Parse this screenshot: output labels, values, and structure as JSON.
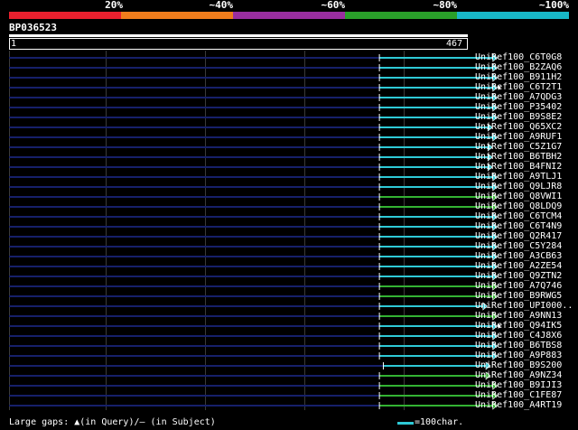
{
  "query": {
    "id": "BP036523",
    "start": "1",
    "end": "467",
    "length": 467
  },
  "identity_scale": {
    "labels": [
      "20%",
      "~40%",
      "~60%",
      "~80%",
      "~100%"
    ],
    "colors": [
      "#e8202e",
      "#f07d1c",
      "#9a2ea0",
      "#2aa02a",
      "#18b8c8"
    ]
  },
  "legend": {
    "gaps": "Large gaps: ▲(in Query)/— (in Subject)",
    "scale": "=100char."
  },
  "hits": [
    {
      "name": "UniRef100_C6T0G8",
      "start": 377,
      "end": 497,
      "color": "#2ec9d6",
      "flag": false
    },
    {
      "name": "UniRef100_B2ZAQ6",
      "start": 377,
      "end": 497,
      "color": "#2ec9d6",
      "flag": false
    },
    {
      "name": "UniRef100_B911H2",
      "start": 377,
      "end": 497,
      "color": "#2ec9d6",
      "flag": false
    },
    {
      "name": "UniRef100_C6T2T1",
      "start": 377,
      "end": 497,
      "color": "#2ec9d6",
      "flag": true
    },
    {
      "name": "UniRef100_A7QDG3",
      "start": 377,
      "end": 497,
      "color": "#2ec9d6",
      "flag": false
    },
    {
      "name": "UniRef100_P35402",
      "start": 377,
      "end": 497,
      "color": "#2ec9d6",
      "flag": false
    },
    {
      "name": "UniRef100_B9S8E2",
      "start": 377,
      "end": 497,
      "color": "#2ec9d6",
      "flag": false
    },
    {
      "name": "UniRef100_Q65XC2",
      "start": 377,
      "end": 492,
      "color": "#2ec9d6",
      "flag": false
    },
    {
      "name": "UniRef100_A9RUF1",
      "start": 377,
      "end": 497,
      "color": "#2ec9d6",
      "flag": false
    },
    {
      "name": "UniRef100_C5Z1G7",
      "start": 377,
      "end": 492,
      "color": "#2ec9d6",
      "flag": false
    },
    {
      "name": "UniRef100_B6TBH2",
      "start": 377,
      "end": 492,
      "color": "#2ec9d6",
      "flag": false
    },
    {
      "name": "UniRef100_B4FNI2",
      "start": 377,
      "end": 492,
      "color": "#2ec9d6",
      "flag": false
    },
    {
      "name": "UniRef100_A9TLJ1",
      "start": 377,
      "end": 497,
      "color": "#2ec9d6",
      "flag": false
    },
    {
      "name": "UniRef100_Q9LJR8",
      "start": 377,
      "end": 497,
      "color": "#2ec9d6",
      "flag": false
    },
    {
      "name": "UniRef100_Q8VWI1",
      "start": 377,
      "end": 497,
      "color": "#33b233",
      "flag": false
    },
    {
      "name": "UniRef100_Q8LDQ9",
      "start": 377,
      "end": 497,
      "color": "#33b233",
      "flag": false
    },
    {
      "name": "UniRef100_C6TCM4",
      "start": 377,
      "end": 497,
      "color": "#2ec9d6",
      "flag": false
    },
    {
      "name": "UniRef100_C6T4N9",
      "start": 377,
      "end": 497,
      "color": "#2ec9d6",
      "flag": false
    },
    {
      "name": "UniRef100_Q2R417",
      "start": 377,
      "end": 497,
      "color": "#2ec9d6",
      "flag": false
    },
    {
      "name": "UniRef100_C5Y284",
      "start": 377,
      "end": 497,
      "color": "#2ec9d6",
      "flag": false
    },
    {
      "name": "UniRef100_A3CB63",
      "start": 377,
      "end": 497,
      "color": "#2ec9d6",
      "flag": false
    },
    {
      "name": "UniRef100_A2ZE54",
      "start": 377,
      "end": 497,
      "color": "#2ec9d6",
      "flag": false
    },
    {
      "name": "UniRef100_Q9ZTN2",
      "start": 377,
      "end": 497,
      "color": "#2ec9d6",
      "flag": false
    },
    {
      "name": "UniRef100_A7Q746",
      "start": 377,
      "end": 497,
      "color": "#33b233",
      "flag": false
    },
    {
      "name": "UniRef100_B9RWG5",
      "start": 377,
      "end": 497,
      "color": "#33b233",
      "flag": false
    },
    {
      "name": "UniRef100_UPI000..",
      "start": 377,
      "end": 487,
      "color": "#2ec9d6",
      "flag": false
    },
    {
      "name": "UniRef100_A9NN13",
      "start": 377,
      "end": 497,
      "color": "#33b233",
      "flag": false
    },
    {
      "name": "UniRef100_Q94IK5",
      "start": 377,
      "end": 497,
      "color": "#2ec9d6",
      "flag": true
    },
    {
      "name": "UniRef100_C4J8X6",
      "start": 377,
      "end": 497,
      "color": "#2ec9d6",
      "flag": false
    },
    {
      "name": "UniRef100_B6TBS8",
      "start": 377,
      "end": 497,
      "color": "#2ec9d6",
      "flag": false
    },
    {
      "name": "UniRef100_A9P883",
      "start": 377,
      "end": 497,
      "color": "#2ec9d6",
      "flag": false
    },
    {
      "name": "UniRef100_B9S200",
      "start": 381,
      "end": 490,
      "color": "#2ec9d6",
      "flag": false
    },
    {
      "name": "UniRef100_A9NZ34",
      "start": 377,
      "end": 490,
      "color": "#33b233",
      "flag": false
    },
    {
      "name": "UniRef100_B9IJI3",
      "start": 377,
      "end": 497,
      "color": "#33b233",
      "flag": false
    },
    {
      "name": "UniRef100_C1FE87",
      "start": 377,
      "end": 497,
      "color": "#33b233",
      "flag": false
    },
    {
      "name": "UniRef100_A4RT19",
      "start": 377,
      "end": 497,
      "color": "#33b233",
      "flag": false
    }
  ]
}
